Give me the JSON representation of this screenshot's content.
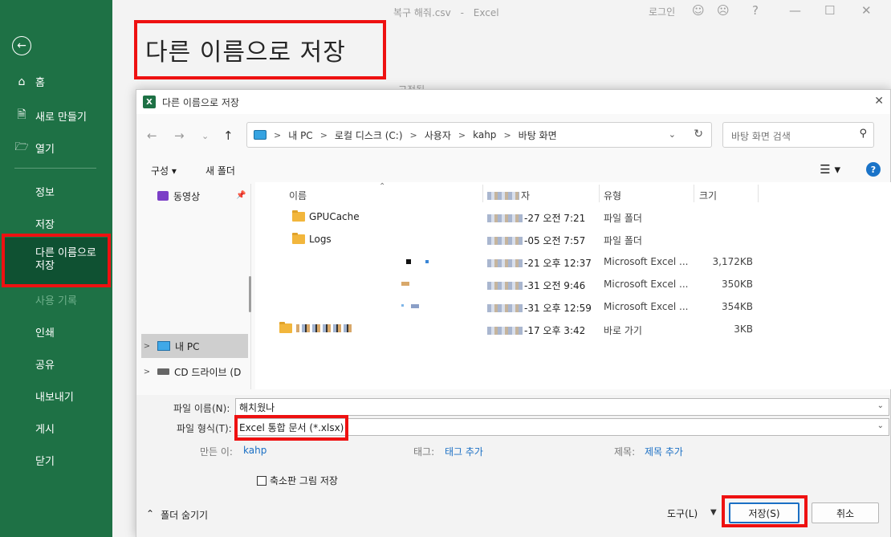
{
  "excel": {
    "title_file": "복구 해줘.csv",
    "title_sep": "-",
    "title_app": "Excel",
    "login": "로그인",
    "heading": "다른 이름으로 저장",
    "bg_text": "고정됨",
    "icons": [
      "smile-icon",
      "frown-icon",
      "help-icon",
      "minimize-icon",
      "maximize-icon",
      "close-icon"
    ]
  },
  "backstage": {
    "items": [
      {
        "label": "홈",
        "icon": "home-icon"
      },
      {
        "label": "새로 만들기",
        "icon": "new-file-icon"
      },
      {
        "label": "열기",
        "icon": "folder-open-icon"
      }
    ],
    "subitems": [
      "정보",
      "저장",
      "다른 이름으로 저장",
      "사용 기록",
      "인쇄",
      "공유",
      "내보내기",
      "게시",
      "닫기"
    ],
    "active": "다른 이름으로 저장",
    "accent": "#1e7145",
    "active_bg": "#0f5132"
  },
  "dialog": {
    "title": "다른 이름으로 저장",
    "breadcrumb": [
      "내 PC",
      "로컬 디스크 (C:)",
      "사용자",
      "kahp",
      "바탕 화면"
    ],
    "search_placeholder": "바탕 화면 검색",
    "organize": "구성",
    "new_folder": "새 폴더",
    "nav_items": [
      {
        "label": "동영상",
        "icon": "video-icon"
      },
      {
        "label": "내 PC",
        "icon": "monitor-icon"
      },
      {
        "label": "CD 드라이브 (D",
        "icon": "cd-drive-icon"
      }
    ],
    "columns": {
      "name": "이름",
      "date": "자",
      "type": "유형",
      "size": "크기"
    },
    "files": [
      {
        "name": "GPUCache",
        "date_tail": "-27 오전 7:21",
        "type": "파일 폴더",
        "size": ""
      },
      {
        "name": "Logs",
        "date_tail": "-05 오전 7:57",
        "type": "파일 폴더",
        "size": ""
      },
      {
        "name": "",
        "date_tail": "-21 오후 12:37",
        "type": "Microsoft Excel ...",
        "size": "3,172KB"
      },
      {
        "name": "",
        "date_tail": "-31 오전 9:46",
        "type": "Microsoft Excel ...",
        "size": "350KB"
      },
      {
        "name": "",
        "date_tail": "-31 오후 12:59",
        "type": "Microsoft Excel ...",
        "size": "354KB"
      },
      {
        "name": "",
        "date_tail": "-17 오후 3:42",
        "type": "바로 가기",
        "size": "3KB"
      }
    ],
    "filename_label": "파일 이름(N):",
    "filename_value": "해치웠나",
    "filetype_label": "파일 형식(T):",
    "filetype_value": "Excel 통합 문서 (*.xlsx)",
    "author_label": "만든 이:",
    "author_value": "kahp",
    "tags_label": "태그:",
    "tags_value": "태그 추가",
    "title_label": "제목:",
    "title_value": "제목 추가",
    "thumbnail_label": "축소판 그림 저장",
    "hide_folders": "폴더 숨기기",
    "tools": "도구(L)",
    "save": "저장(S)",
    "cancel": "취소"
  },
  "highlight_color": "#ee1111"
}
